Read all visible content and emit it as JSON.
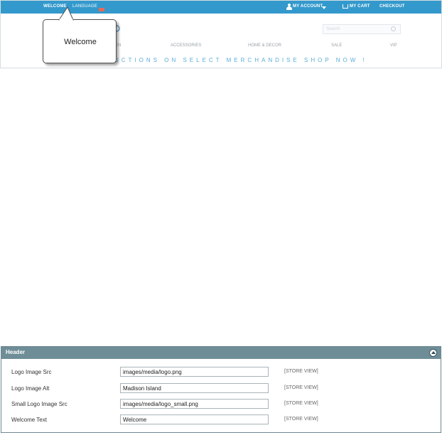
{
  "storefront": {
    "topbar": {
      "welcome": "WELCOME",
      "language": "LANGUAGE",
      "my_account": "MY ACCOUNT",
      "my_cart": "MY CART",
      "checkout": "CHECKOUT"
    },
    "search": {
      "placeholder": "Search"
    },
    "nav": [
      "EN",
      "ACCESSORIES",
      "HOME & DECOR",
      "SALE",
      "VIP"
    ],
    "banner": "UCTIONS ON SELECT MERCHANDISE   SHOP NOW !",
    "callout": "Welcome",
    "colors": {
      "topbar": "#3399cc",
      "banner": "#4aa4d6"
    }
  },
  "panel": {
    "title": "Header",
    "rows": [
      {
        "label": "Logo Image Src",
        "value": "images/media/logo.png",
        "scope": "[STORE VIEW]"
      },
      {
        "label": "Logo Image Alt",
        "value": "Madison Island",
        "scope": "[STORE VIEW]"
      },
      {
        "label": "Small Logo Image Src",
        "value": "images/media/logo_small.png",
        "scope": "[STORE VIEW]"
      },
      {
        "label": "Welcome Text",
        "value": "Welcome",
        "scope": "[STORE VIEW]"
      }
    ],
    "colors": {
      "header": "#6e8d97"
    }
  }
}
